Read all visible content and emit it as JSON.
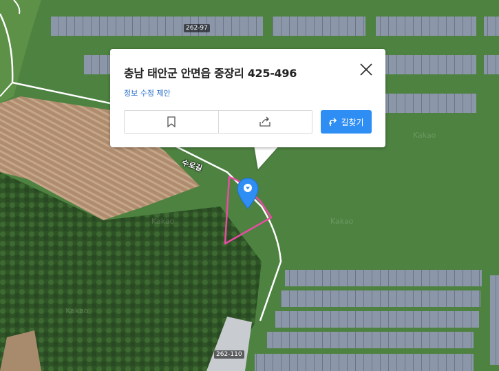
{
  "map": {
    "parcel_labels": [
      "262-97",
      "262-110"
    ],
    "road_label": "수로길",
    "watermarks": [
      "Kakao",
      "Kakao",
      "Kakao",
      "Kakao"
    ]
  },
  "popup": {
    "title": "충남 태안군 안면읍 중장리 425-496",
    "edit_link": "정보 수정 제안",
    "route_label": "길찾기",
    "close_icon": "close-icon",
    "bookmark_icon": "bookmark-icon",
    "share_icon": "share-icon",
    "route_icon": "directions-icon"
  },
  "marker": {
    "icon": "location-pin-icon",
    "color": "#2f8ef4"
  },
  "parcel_outline_color": "#e94ca3"
}
